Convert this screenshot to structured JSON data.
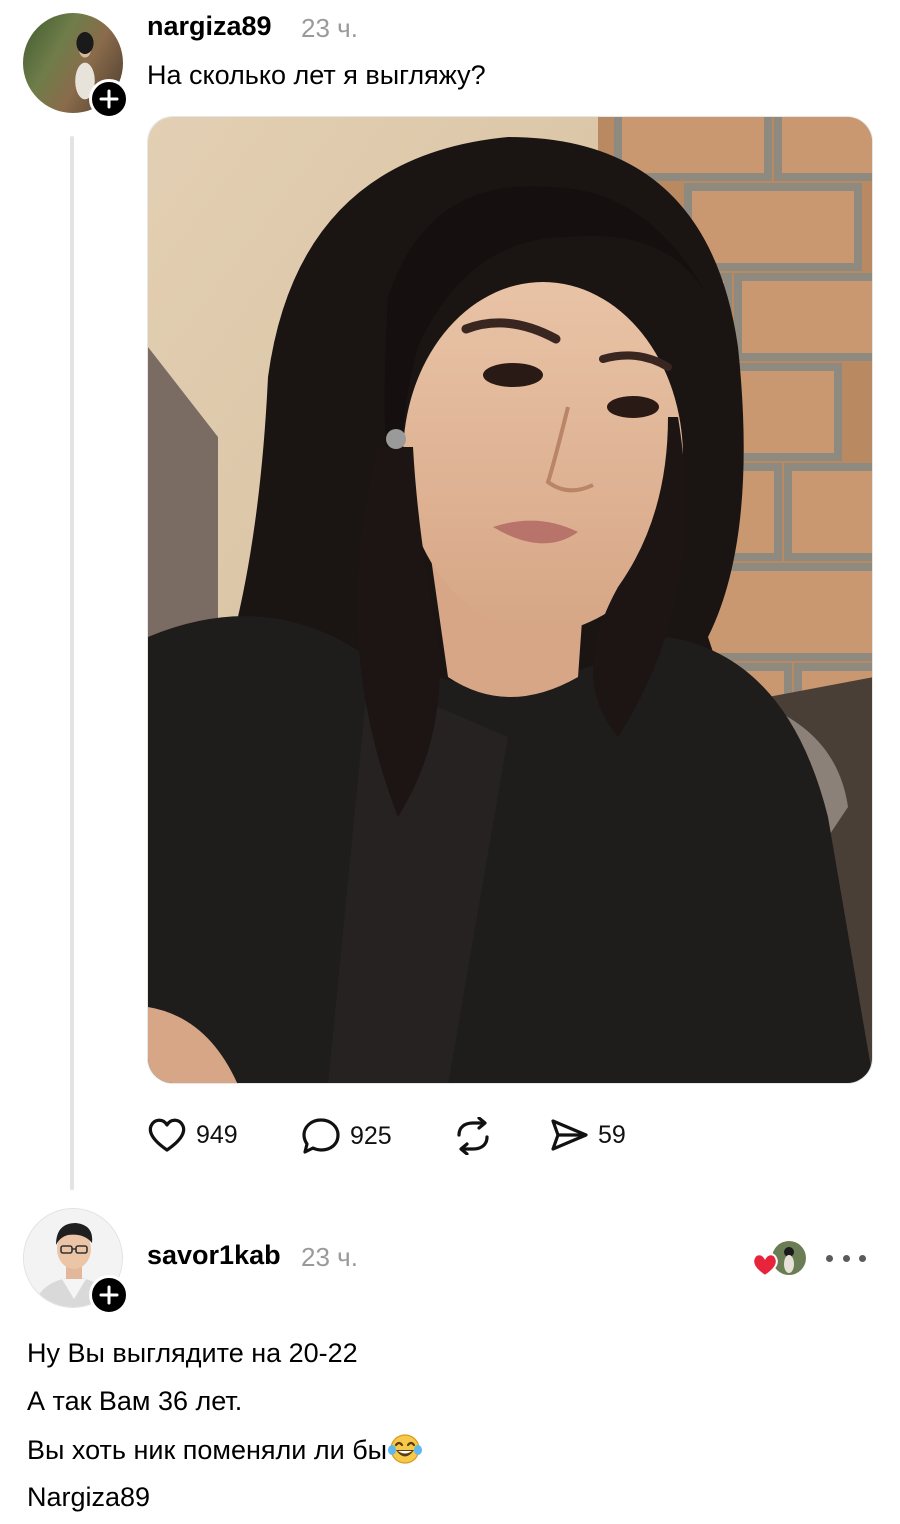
{
  "post": {
    "username": "nargiza89",
    "time": "23 ч.",
    "text": "На сколько лет я выгляжу?",
    "photo_icon": "selfie-photo",
    "actions": {
      "likes": "949",
      "comments": "925",
      "shares": "59"
    }
  },
  "reply": {
    "username": "savor1kab",
    "time": "23 ч.",
    "lines": [
      "Ну Вы выглядите на 20-22",
      "А так Вам 36 лет.",
      "Вы хоть ник поменяли ли бы",
      "Nargiza89"
    ],
    "emoji_icon": "laughing-tears-emoji"
  },
  "colors": {
    "text": "#000000",
    "muted": "#9a9a9a",
    "heart_red": "#e8243c",
    "thread_line": "#e3e3e3"
  }
}
